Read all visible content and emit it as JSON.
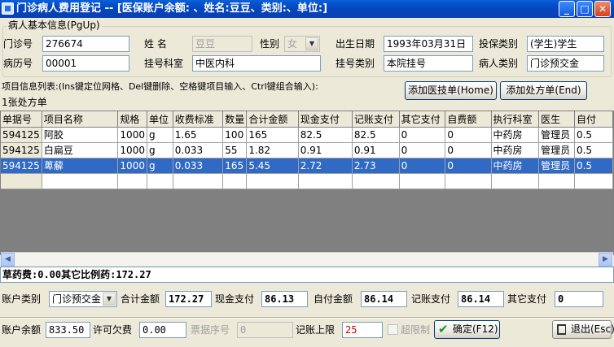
{
  "window": {
    "title": "门诊病人费用登记 -- [医保账户余额: 、姓名:豆豆、类别:、单位:]",
    "minimize": "_",
    "maximize": "□",
    "close": "✕"
  },
  "patient_section": {
    "legend": "病人基本信息(PgUp)",
    "clinic_no_label": "门诊号",
    "clinic_no": "276674",
    "name_label": "姓    名",
    "name": "豆豆",
    "gender_label": "性别",
    "gender": "女",
    "birth_label": "出生日期",
    "birth": "1993年03月31日",
    "insurance_type_label": "投保类别",
    "insurance_type": "(学生)学生",
    "record_no_label": "病历号",
    "record_no": "00001",
    "reg_dept_label": "挂号科室",
    "reg_dept": "中医内科",
    "reg_type_label": "挂号类别",
    "reg_type": "本院挂号",
    "patient_type_label": "病人类别",
    "patient_type": "门诊预交金"
  },
  "items_section": {
    "hint": "项目信息列表:(Ins键定位网格、Del键删除、空格键项目输入、Ctrl键组合输入):",
    "add_tech_button": "添加医技单(Home)",
    "add_rx_button": "添加处方单(End)",
    "rx_count": "1张处方单"
  },
  "grid": {
    "columns": [
      "单据号",
      "项目名称",
      "规格",
      "单位",
      "收费标准",
      "数量",
      "合计金额",
      "现金支付",
      "记账支付",
      "其它支付",
      "自费额",
      "执行科室",
      "医生",
      "自付"
    ],
    "rows": [
      [
        "594125",
        "阿胶",
        "1000",
        "g",
        "1.65",
        "100",
        "165",
        "82.5",
        "82.5",
        "0",
        "0",
        "中药房",
        "管理员",
        "0.5"
      ],
      [
        "594125",
        "白扁豆",
        "1000",
        "g",
        "0.033",
        "55",
        "1.82",
        "0.91",
        "0.91",
        "0",
        "0",
        "中药房",
        "管理员",
        "0.5"
      ],
      [
        "594125",
        "萆薢",
        "1000",
        "g",
        "0.033",
        "165",
        "5.45",
        "2.72",
        "2.73",
        "0",
        "0",
        "中药房",
        "管理员",
        "0.5"
      ],
      [
        "",
        "",
        "",
        "",
        "",
        "",
        "",
        "",
        "",
        "",
        "",
        "",
        "",
        ""
      ]
    ],
    "selected_row": 2
  },
  "summary": {
    "text": "草药费:0.00其它比例药:172.27"
  },
  "totals": {
    "account_type_label": "账户类别",
    "account_type": "门诊预交金",
    "total_label": "合计金额",
    "total": "172.27",
    "cash_label": "现金支付",
    "cash": "86.13",
    "self_label": "自付金额",
    "self": "86.14",
    "account_label": "记账支付",
    "account": "86.14",
    "other_label": "其它支付",
    "other": "0"
  },
  "footer": {
    "balance_label": "账户余额",
    "balance": "833.50",
    "allow_debt_label": "许可欠费",
    "allow_debt": "0.00",
    "invoice_no_label": "票据序号",
    "invoice_no": "0",
    "limit_label": "记账上限",
    "limit": "25",
    "over_limit_label": "超限制",
    "confirm_button": "确定(F12)",
    "exit_button": "退出(Esc)"
  }
}
